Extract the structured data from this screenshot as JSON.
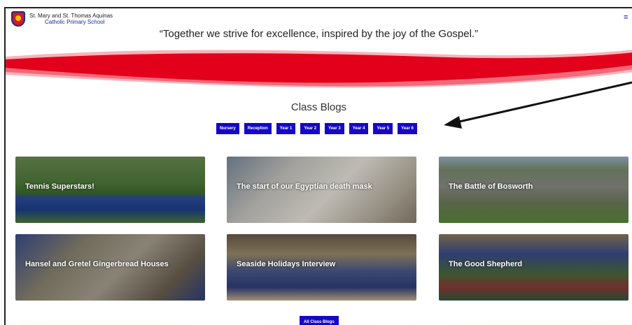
{
  "header": {
    "school_line1": "St. Mary and St. Thomas Aquinas",
    "school_line2": "Catholic Primary School",
    "menu_icon": "hamburger-icon"
  },
  "motto": "“Together we strive for excellence, inspired by the joy of the Gospel.”",
  "blogs": {
    "title": "Class Blogs",
    "classes": [
      "Nursery",
      "Reception",
      "Year 1",
      "Year 2",
      "Year 3",
      "Year 4",
      "Year 5",
      "Year 6"
    ],
    "cards": [
      {
        "title": "Tennis Superstars!"
      },
      {
        "title": "The start of our Egyptian death mask"
      },
      {
        "title": "The Battle of Bosworth"
      },
      {
        "title": "Hansel and Gretel Gingerbread Houses"
      },
      {
        "title": "Seaside Holidays Interview"
      },
      {
        "title": "The Good Shepherd"
      }
    ],
    "all_button": "All Class Blogs"
  },
  "colors": {
    "accent_blue": "#1407c9",
    "wave_red": "#e3001b",
    "glow_yellow": "#ffe066"
  }
}
